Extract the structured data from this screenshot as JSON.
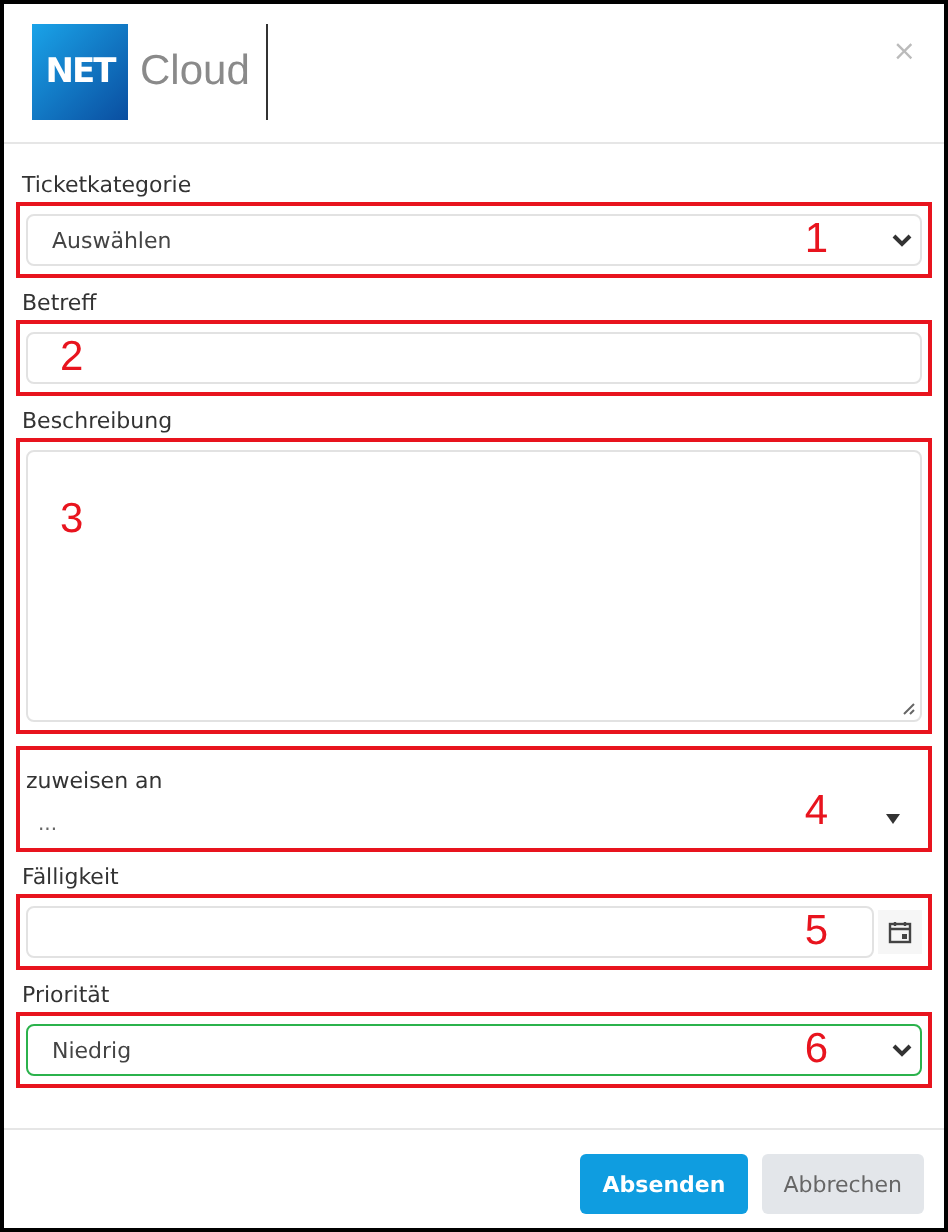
{
  "header": {
    "logo_mark": "NET",
    "logo_text": "Cloud",
    "close": "×"
  },
  "fields": [
    {
      "kind": "select",
      "label": "Ticketkategorie",
      "value": "Auswählen",
      "marker": "1",
      "label_in_marker": false,
      "highlighted": false
    },
    {
      "kind": "text",
      "label": "Betreff",
      "marker": "2",
      "label_in_marker": false,
      "highlighted": false
    },
    {
      "kind": "textarea",
      "label": "Beschreibung",
      "marker": "3",
      "label_in_marker": false,
      "highlighted": false
    },
    {
      "kind": "combo",
      "label": "zuweisen an",
      "value": "...",
      "marker": "4",
      "label_in_marker": true,
      "highlighted": false
    },
    {
      "kind": "date",
      "label": "Fälligkeit",
      "marker": "5",
      "label_in_marker": false,
      "highlighted": false
    },
    {
      "kind": "select",
      "label": "Priorität",
      "value": "Niedrig",
      "marker": "6",
      "label_in_marker": false,
      "highlighted": true
    }
  ],
  "buttons": [
    {
      "label": "Absenden",
      "kind": "primary"
    },
    {
      "label": "Abbrechen",
      "kind": "secondary"
    }
  ]
}
